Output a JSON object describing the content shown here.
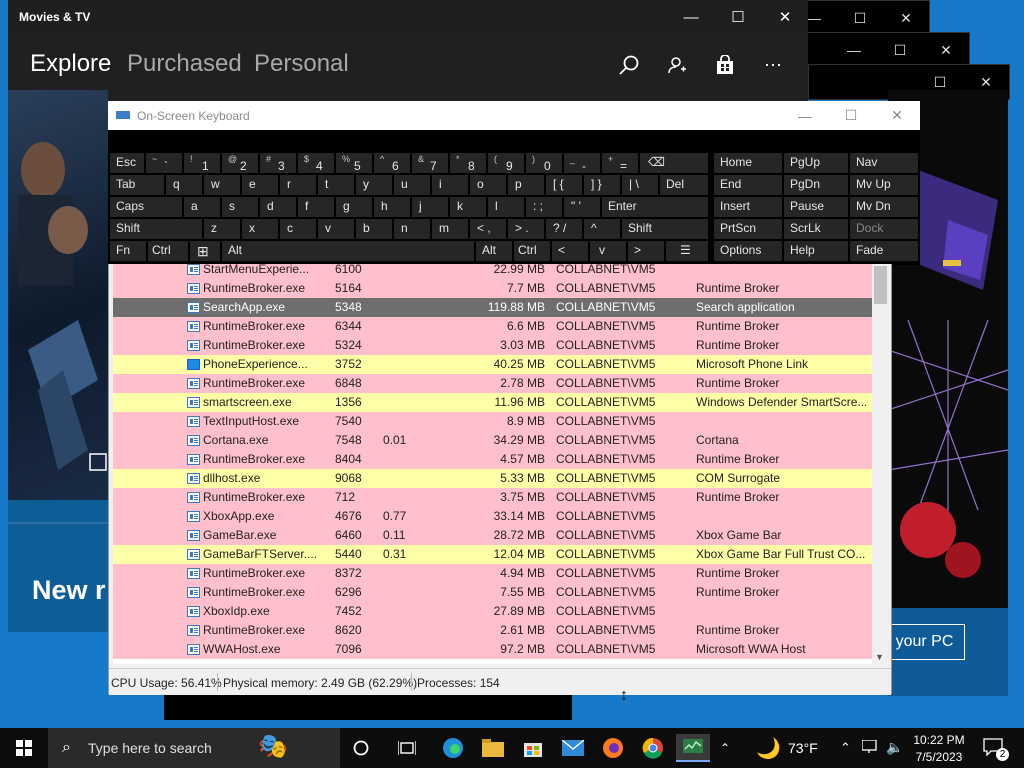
{
  "movies": {
    "title": "Movies & TV",
    "nav": [
      "Explore",
      "Purchased",
      "Personal"
    ],
    "hero_text": "New r",
    "cta": "your PC",
    "controls": {
      "minimize": "—",
      "maximize": "☐",
      "close": "✕"
    }
  },
  "osk": {
    "title": "On-Screen Keyboard",
    "controls": {
      "minimize": "—",
      "maximize": "☐",
      "close": "✕"
    },
    "row1": [
      {
        "main": "Esc"
      },
      {
        "sub": "~",
        "main": "`"
      },
      {
        "sub": "!",
        "main": "1"
      },
      {
        "sub": "@",
        "main": "2"
      },
      {
        "sub": "#",
        "main": "3"
      },
      {
        "sub": "$",
        "main": "4"
      },
      {
        "sub": "%",
        "main": "5"
      },
      {
        "sub": "^",
        "main": "6"
      },
      {
        "sub": "&",
        "main": "7"
      },
      {
        "sub": "*",
        "main": "8"
      },
      {
        "sub": "(",
        "main": "9"
      },
      {
        "sub": ")",
        "main": "0"
      },
      {
        "sub": "_",
        "main": "-"
      },
      {
        "sub": "+",
        "main": "="
      },
      {
        "main": "⌫"
      }
    ],
    "row2": [
      "Tab",
      "q",
      "w",
      "e",
      "r",
      "t",
      "y",
      "u",
      "i",
      "o",
      "p",
      "[ {",
      "] }",
      "| \\",
      "Del"
    ],
    "row3": [
      "Caps",
      "a",
      "s",
      "d",
      "f",
      "g",
      "h",
      "j",
      "k",
      "l",
      ": ;",
      "\" '",
      "Enter"
    ],
    "row4": [
      "Shift",
      "z",
      "x",
      "c",
      "v",
      "b",
      "n",
      "m",
      "< ,",
      "> .",
      "? /",
      "^",
      "Shift"
    ],
    "row5": [
      "Fn",
      "Ctrl",
      "⊞",
      "Alt",
      "Alt",
      "Ctrl",
      "<",
      "v",
      ">",
      "☰"
    ],
    "nav_keys": [
      [
        "Home",
        "PgUp",
        "Nav"
      ],
      [
        "End",
        "PgDn",
        "Mv Up"
      ],
      [
        "Insert",
        "Pause",
        "Mv Dn"
      ],
      [
        "PrtScn",
        "ScrLk",
        "Dock"
      ],
      [
        "Options",
        "Help",
        "Fade"
      ]
    ]
  },
  "tasks": {
    "rows": [
      {
        "name": "StartMenuExperie...",
        "pid": "6100",
        "cpu": "",
        "mem": "22.99 MB",
        "user": "COLLABNET\\VM5",
        "desc": "",
        "color": "#ffc0cb"
      },
      {
        "name": "RuntimeBroker.exe",
        "pid": "5164",
        "cpu": "",
        "mem": "7.7 MB",
        "user": "COLLABNET\\VM5",
        "desc": "Runtime Broker",
        "color": "#ffc0cb"
      },
      {
        "name": "SearchApp.exe",
        "pid": "5348",
        "cpu": "",
        "mem": "119.88 MB",
        "user": "COLLABNET\\VM5",
        "desc": "Search application",
        "color": "#6e6e6e",
        "selected": true
      },
      {
        "name": "RuntimeBroker.exe",
        "pid": "6344",
        "cpu": "",
        "mem": "6.6 MB",
        "user": "COLLABNET\\VM5",
        "desc": "Runtime Broker",
        "color": "#ffc0cb"
      },
      {
        "name": "RuntimeBroker.exe",
        "pid": "5324",
        "cpu": "",
        "mem": "3.03 MB",
        "user": "COLLABNET\\VM5",
        "desc": "Runtime Broker",
        "color": "#ffc0cb"
      },
      {
        "name": "PhoneExperience...",
        "pid": "3752",
        "cpu": "",
        "mem": "40.25 MB",
        "user": "COLLABNET\\VM5",
        "desc": "Microsoft Phone Link",
        "color": "#ffffa8",
        "phone": true
      },
      {
        "name": "RuntimeBroker.exe",
        "pid": "6848",
        "cpu": "",
        "mem": "2.78 MB",
        "user": "COLLABNET\\VM5",
        "desc": "Runtime Broker",
        "color": "#ffc0cb"
      },
      {
        "name": "smartscreen.exe",
        "pid": "1356",
        "cpu": "",
        "mem": "11.96 MB",
        "user": "COLLABNET\\VM5",
        "desc": "Windows Defender SmartScre...",
        "color": "#ffffa8"
      },
      {
        "name": "TextInputHost.exe",
        "pid": "7540",
        "cpu": "",
        "mem": "8.9 MB",
        "user": "COLLABNET\\VM5",
        "desc": "",
        "color": "#ffc0cb"
      },
      {
        "name": "Cortana.exe",
        "pid": "7548",
        "cpu": "0.01",
        "mem": "34.29 MB",
        "user": "COLLABNET\\VM5",
        "desc": "Cortana",
        "color": "#ffc0cb"
      },
      {
        "name": "RuntimeBroker.exe",
        "pid": "8404",
        "cpu": "",
        "mem": "4.57 MB",
        "user": "COLLABNET\\VM5",
        "desc": "Runtime Broker",
        "color": "#ffc0cb"
      },
      {
        "name": "dllhost.exe",
        "pid": "9068",
        "cpu": "",
        "mem": "5.33 MB",
        "user": "COLLABNET\\VM5",
        "desc": "COM Surrogate",
        "color": "#ffffa8"
      },
      {
        "name": "RuntimeBroker.exe",
        "pid": "712",
        "cpu": "",
        "mem": "3.75 MB",
        "user": "COLLABNET\\VM5",
        "desc": "Runtime Broker",
        "color": "#ffc0cb"
      },
      {
        "name": "XboxApp.exe",
        "pid": "4676",
        "cpu": "0.77",
        "mem": "33.14 MB",
        "user": "COLLABNET\\VM5",
        "desc": "",
        "color": "#ffc0cb"
      },
      {
        "name": "GameBar.exe",
        "pid": "6460",
        "cpu": "0.11",
        "mem": "28.72 MB",
        "user": "COLLABNET\\VM5",
        "desc": "Xbox Game Bar",
        "color": "#ffc0cb"
      },
      {
        "name": "GameBarFTServer....",
        "pid": "5440",
        "cpu": "0.31",
        "mem": "12.04 MB",
        "user": "COLLABNET\\VM5",
        "desc": "Xbox Game Bar Full Trust CO...",
        "color": "#ffffa8"
      },
      {
        "name": "RuntimeBroker.exe",
        "pid": "8372",
        "cpu": "",
        "mem": "4.94 MB",
        "user": "COLLABNET\\VM5",
        "desc": "Runtime Broker",
        "color": "#ffc0cb"
      },
      {
        "name": "RuntimeBroker.exe",
        "pid": "6296",
        "cpu": "",
        "mem": "7.55 MB",
        "user": "COLLABNET\\VM5",
        "desc": "Runtime Broker",
        "color": "#ffc0cb"
      },
      {
        "name": "XboxIdp.exe",
        "pid": "7452",
        "cpu": "",
        "mem": "27.89 MB",
        "user": "COLLABNET\\VM5",
        "desc": "",
        "color": "#ffc0cb"
      },
      {
        "name": "RuntimeBroker.exe",
        "pid": "8620",
        "cpu": "",
        "mem": "2.61 MB",
        "user": "COLLABNET\\VM5",
        "desc": "Runtime Broker",
        "color": "#ffc0cb"
      },
      {
        "name": "WWAHost.exe",
        "pid": "7096",
        "cpu": "",
        "mem": "97.2 MB",
        "user": "COLLABNET\\VM5",
        "desc": "Microsoft WWA Host",
        "color": "#ffc0cb"
      }
    ],
    "status": {
      "cpu": "CPU Usage: 56.41%",
      "memory": "Physical memory: 2.49 GB (62.29%)",
      "processes": "Processes: 154"
    }
  },
  "taskbar": {
    "search_placeholder": "Type here to search",
    "weather": "73°F",
    "time": "10:22 PM",
    "date": "7/5/2023",
    "notifications": "2"
  }
}
